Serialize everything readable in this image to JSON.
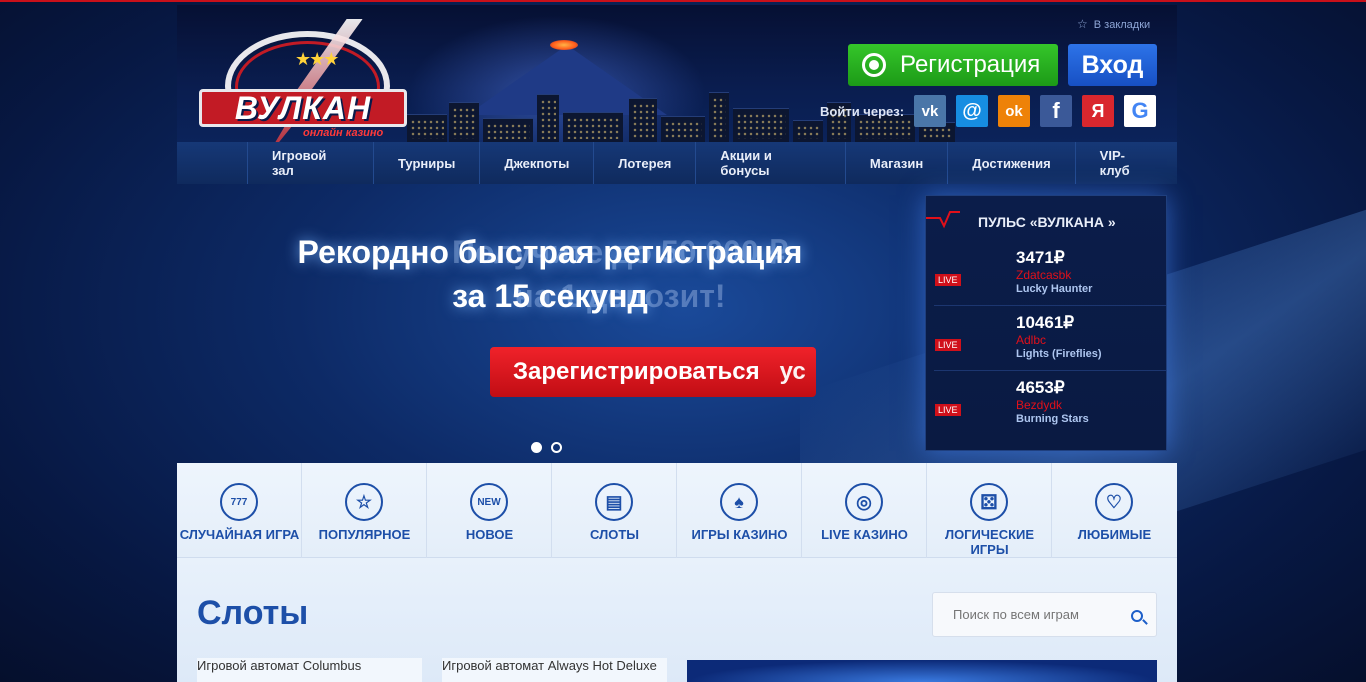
{
  "header": {
    "logo_text": "ВУЛКАН",
    "logo_subtext": "онлайн казино",
    "bookmark": "В закладки",
    "register_button": "Регистрация",
    "login_button": "Вход",
    "login_via": "Войти через:",
    "social": [
      {
        "name": "vk",
        "glyph": "vk",
        "color": "#4a76a8"
      },
      {
        "name": "mail",
        "glyph": "@",
        "color": "#168de2"
      },
      {
        "name": "ok",
        "glyph": "ok",
        "color": "#ee8208"
      },
      {
        "name": "facebook",
        "glyph": "f",
        "color": "#3b5998"
      },
      {
        "name": "yandex",
        "glyph": "Я",
        "color": "#d9272e"
      },
      {
        "name": "google",
        "glyph": "G",
        "color": "#ffffff"
      }
    ]
  },
  "nav": {
    "items": [
      "Игровой зал",
      "Турниры",
      "Джекпоты",
      "Лотерея",
      "Акции и бонусы",
      "Магазин",
      "Достижения",
      "VIP-клуб"
    ]
  },
  "hero": {
    "title_line1": "Рекордно быстрая регистрация",
    "title_line2": "за 15 секунд",
    "ghost_line1": "Получите до 50 000 ₽",
    "ghost_line2": "на 1 депозит!",
    "button": "Зарегистрироваться",
    "button_ghost": "ус",
    "slides": 2,
    "active_slide": 1
  },
  "pulse": {
    "title": "ПУЛЬС «ВУЛКАНА »",
    "live_label": "LIVE",
    "rows": [
      {
        "amount": "3471₽",
        "user": "Zdatcasbk",
        "game": "Lucky Haunter"
      },
      {
        "amount": "10461₽",
        "user": "Adlbc",
        "game": "Lights (Fireflies)"
      },
      {
        "amount": "4653₽",
        "user": "Bezdydk",
        "game": "Burning Stars"
      }
    ]
  },
  "categories": [
    {
      "label": "СЛУЧАЙНАЯ ИГРА",
      "icon": "777"
    },
    {
      "label": "ПОПУЛЯРНОЕ",
      "icon": "☆"
    },
    {
      "label": "НОВОЕ",
      "icon": "NEW"
    },
    {
      "label": "СЛОТЫ",
      "icon": "▤"
    },
    {
      "label": "ИГРЫ КАЗИНО",
      "icon": "♠"
    },
    {
      "label": "LIVE КАЗИНО",
      "icon": "◎"
    },
    {
      "label": "ЛОГИЧЕСКИЕ ИГРЫ",
      "icon": "⚄"
    },
    {
      "label": "ЛЮБИМЫЕ",
      "icon": "♡"
    }
  ],
  "content": {
    "section_title": "Слоты",
    "search_placeholder": "Поиск по всем играм",
    "games": [
      "Игровой автомат Columbus",
      "Игровой автомат Always Hot Deluxe"
    ]
  }
}
